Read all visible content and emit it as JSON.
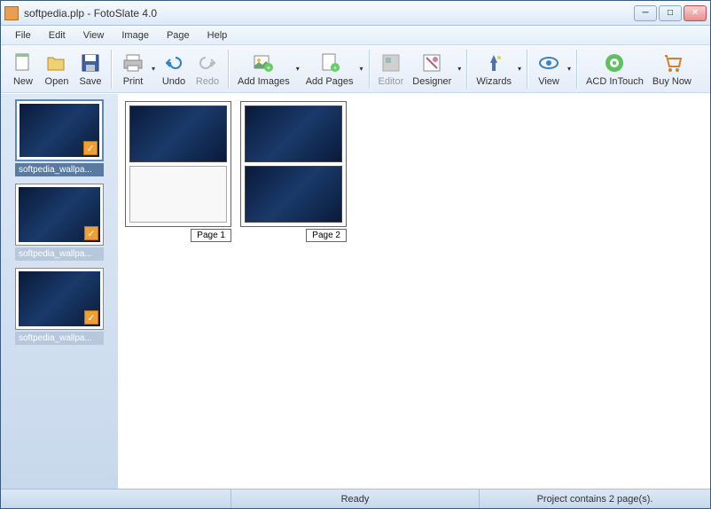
{
  "window": {
    "title": "softpedia.plp - FotoSlate 4.0"
  },
  "menubar": {
    "items": [
      "File",
      "Edit",
      "View",
      "Image",
      "Page",
      "Help"
    ]
  },
  "toolbar": {
    "new": "New",
    "open": "Open",
    "save": "Save",
    "print": "Print",
    "undo": "Undo",
    "redo": "Redo",
    "add_images": "Add Images",
    "add_pages": "Add Pages",
    "editor": "Editor",
    "designer": "Designer",
    "wizards": "Wizards",
    "view": "View",
    "acd_intouch": "ACD InTouch",
    "buy_now": "Buy Now"
  },
  "sidebar": {
    "thumbs": [
      {
        "label": "softpedia_wallpa..."
      },
      {
        "label": "softpedia_wallpa..."
      },
      {
        "label": "softpedia_wallpa..."
      }
    ]
  },
  "pages": [
    {
      "label": "Page 1",
      "slots": [
        true,
        false
      ]
    },
    {
      "label": "Page 2",
      "slots": [
        true,
        true
      ]
    }
  ],
  "status": {
    "ready": "Ready",
    "project": "Project contains 2 page(s)."
  }
}
